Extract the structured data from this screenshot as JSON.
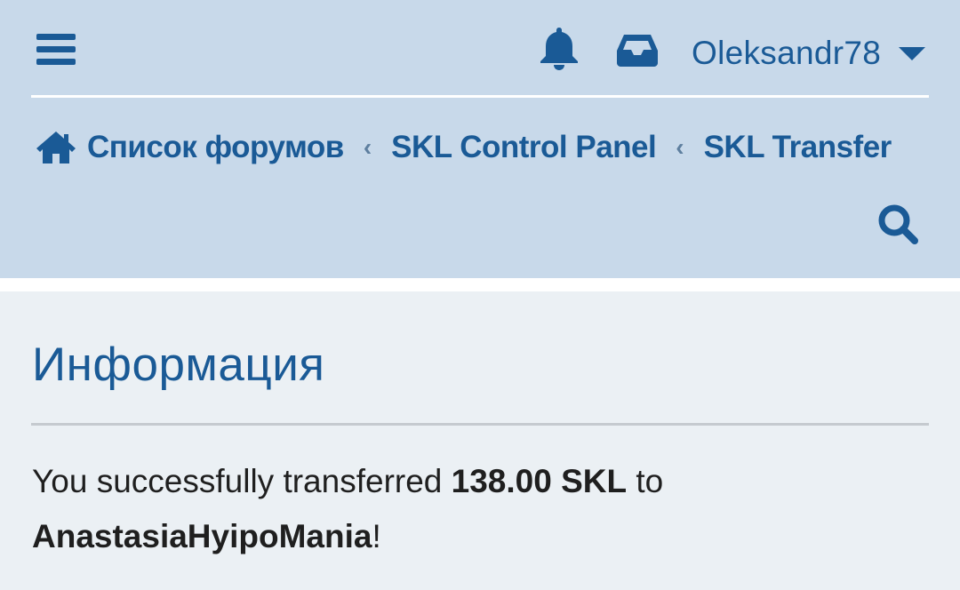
{
  "header": {
    "user": {
      "name": "Oleksandr78"
    },
    "icons": {
      "menu": "hamburger-menu-icon",
      "alerts": "bell-icon",
      "inbox": "inbox-icon",
      "dropdown": "caret-down-icon",
      "home": "home-icon",
      "search": "search-icon"
    },
    "breadcrumb": [
      {
        "label": "Список форумов"
      },
      {
        "label": "SKL Control Panel"
      },
      {
        "label": "SKL Transfer"
      }
    ],
    "separator": "‹"
  },
  "main": {
    "title": "Информация",
    "message": {
      "prefix": "You successfully transferred ",
      "amount": "138.00 SKL",
      "middle": " to",
      "recipient": "AnastasiaHyipoMania",
      "suffix": "!"
    }
  },
  "colors": {
    "header_bg": "#c8d9ea",
    "content_bg": "#ebf0f4",
    "accent": "#1a5a96",
    "text": "#1f1f1f"
  }
}
